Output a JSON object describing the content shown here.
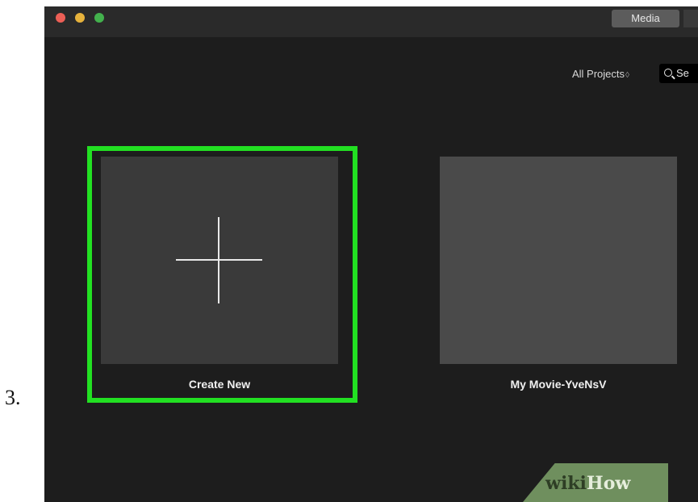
{
  "step": {
    "number": "3."
  },
  "window": {
    "toolbar": {
      "media_label": "Media"
    },
    "browser": {
      "filter_label": "All Projects",
      "filter_arrows": "◊",
      "search_text": "Se"
    },
    "projects": [
      {
        "label": "Create New"
      },
      {
        "label": "My Movie-YveNsV"
      }
    ]
  },
  "watermark": {
    "wiki": "wiki",
    "how": "How"
  },
  "colors": {
    "highlight": "#22e022",
    "window_bg": "#1d1d1d",
    "tile_bg": "#3a3a3a"
  }
}
